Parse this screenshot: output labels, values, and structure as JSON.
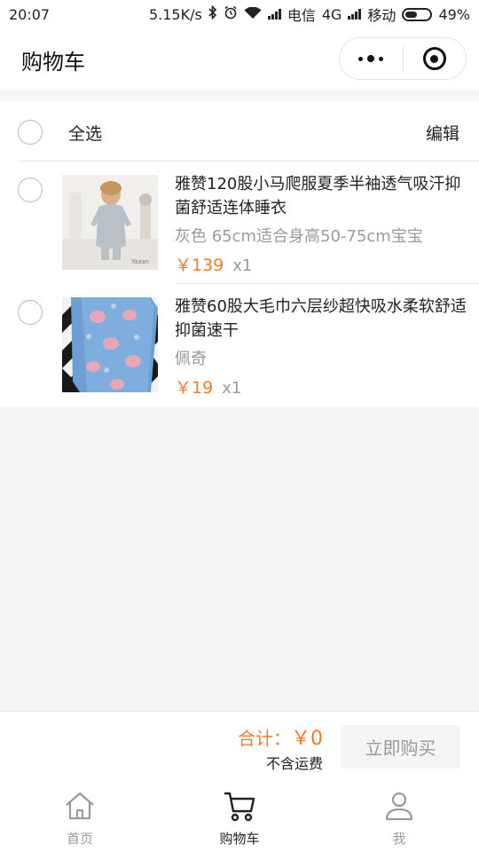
{
  "status_bar": {
    "time": "20:07",
    "speed": "5.15K/s",
    "carrier1": "电信",
    "network": "4G",
    "carrier2": "移动",
    "battery": "49%",
    "battery_level": 0.49
  },
  "header": {
    "title": "购物车",
    "more_icon": "more-dots-icon",
    "close_icon": "target-circle-icon"
  },
  "cart": {
    "select_all_label": "全选",
    "edit_label": "编辑",
    "items": [
      {
        "title": "雅赞120股小马爬服夏季半袖透气吸汗抑菌舒适连体睡衣",
        "spec": "灰色 65cm适合身高50-75cm宝宝",
        "price": "￥139",
        "qty": "x1",
        "thumb_label": "Yazan"
      },
      {
        "title": "雅赞60股大毛巾六层纱超快吸水柔软舒适抑菌速干",
        "spec": "佩奇",
        "price": "￥19",
        "qty": "x1"
      }
    ]
  },
  "checkout": {
    "total_label": "合计：",
    "total_amount": "￥0",
    "shipping_note": "不含运费",
    "buy_label": "立即购买"
  },
  "tabbar": {
    "tabs": [
      {
        "label": "首页",
        "icon": "home-icon"
      },
      {
        "label": "购物车",
        "icon": "cart-icon"
      },
      {
        "label": "我",
        "icon": "profile-icon"
      }
    ],
    "active_index": 1
  },
  "colors": {
    "accent_orange": "#f07b2a",
    "muted_text": "#9a9a9a",
    "page_bg": "#f5f5f5"
  }
}
